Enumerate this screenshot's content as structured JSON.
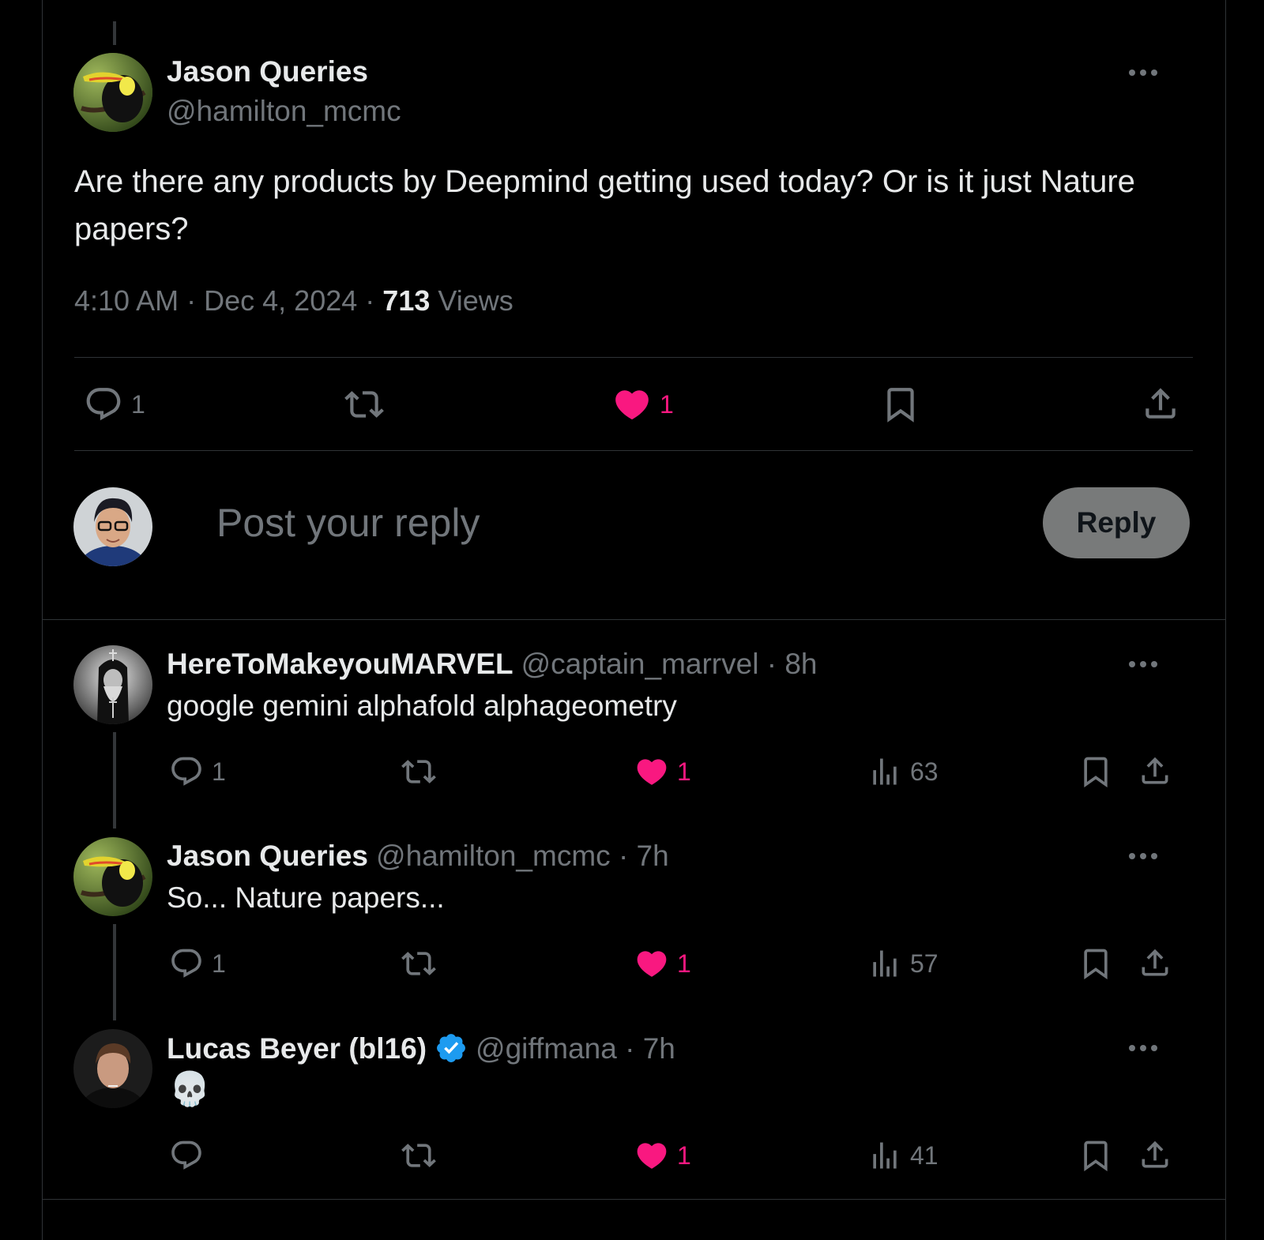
{
  "main_post": {
    "author_name": "Jason Queries",
    "handle": "@hamilton_mcmc",
    "text": "Are there any products by Deepmind getting used today? Or is it just Nature papers?",
    "time": "4:10 AM",
    "date": "Dec 4, 2024",
    "separator": "·",
    "views_count": "713",
    "views_label": "Views",
    "actions": {
      "replies": "1",
      "likes": "1"
    }
  },
  "composer": {
    "placeholder": "Post your reply",
    "reply_button_label": "Reply"
  },
  "replies": [
    {
      "author_name": "HereToMakeyouMARVEL",
      "handle": "@captain_marrvel",
      "separator": "·",
      "time_ago": "8h",
      "text": "google gemini alphafold alphageometry",
      "reply_count": "1",
      "like_count": "1",
      "view_count": "63"
    },
    {
      "author_name": "Jason Queries",
      "handle": "@hamilton_mcmc",
      "separator": "·",
      "time_ago": "7h",
      "text": "So... Nature papers...",
      "reply_count": "1",
      "like_count": "1",
      "view_count": "57"
    },
    {
      "author_name": "Lucas Beyer (bl16)",
      "verified": true,
      "handle": "@giffmana",
      "separator": "·",
      "time_ago": "7h",
      "text": "💀",
      "reply_count": "",
      "like_count": "1",
      "view_count": "41"
    }
  ],
  "colors": {
    "background": "#000000",
    "text_primary": "#e7e9ea",
    "text_muted": "#71767b",
    "like_pink": "#f91880",
    "verified_blue": "#1d9bf0",
    "reply_button_bg": "#787a7a"
  },
  "icons": [
    "more-icon",
    "reply-icon",
    "repost-icon",
    "like-icon",
    "bookmark-icon",
    "share-icon",
    "views-icon",
    "verified-icon"
  ]
}
